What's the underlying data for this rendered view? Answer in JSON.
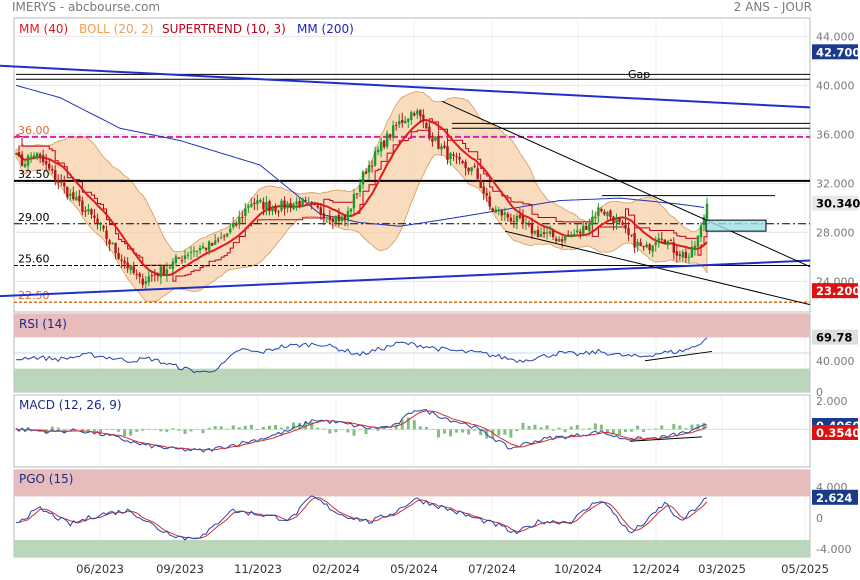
{
  "header": {
    "left": "IMERYS - abcbourse.com",
    "right": "2 ANS - JOUR"
  },
  "legend": [
    {
      "label": "MM (40)",
      "color": "#e31a1c"
    },
    {
      "label": "BOLL (20, 2)",
      "color": "#f0a050"
    },
    {
      "label": "SUPERTREND (10, 3)",
      "color": "#c0001b"
    },
    {
      "label": "MM (200)",
      "color": "#2222cc"
    }
  ],
  "x_labels": [
    "06/2023",
    "09/2023",
    "11/2023",
    "02/2024",
    "05/2024",
    "07/2024",
    "10/2024",
    "12/2024",
    "03/2025",
    "05/2025"
  ],
  "annotations": {
    "gap": "Gap"
  },
  "chart_data": [
    {
      "type": "candlestick",
      "name": "main",
      "y_ticks": [
        "44.000",
        "40.000",
        "36.000",
        "32.000",
        "28.000",
        "24.000"
      ],
      "ylim": [
        21.5,
        45.5
      ],
      "levels": [
        {
          "label": "36.00",
          "value": 35.8,
          "color": "#dd1fb0"
        },
        {
          "label": "32.50",
          "value": 32.2,
          "color": "#000000"
        },
        {
          "label": "29.00",
          "value": 28.7,
          "color": "#000000"
        },
        {
          "label": "25.60",
          "value": 25.3,
          "color": "#000000"
        },
        {
          "label": "22.50",
          "value": 22.3,
          "color": "#e07010"
        }
      ],
      "badges": [
        {
          "label": "42.700",
          "value": 42.7,
          "bg": "#1a3a8a",
          "fg": "#ffffff"
        },
        {
          "label": "30.340",
          "value": 30.34,
          "bg": "#e8e8e8",
          "fg": "#000000"
        },
        {
          "label": "23.200",
          "value": 23.2,
          "bg": "#dd1111",
          "fg": "#ffffff"
        }
      ],
      "close_key": [
        [
          0,
          40.0
        ],
        [
          10,
          37.0
        ],
        [
          20,
          33.5
        ],
        [
          35,
          34.5
        ],
        [
          50,
          33.0
        ],
        [
          70,
          31.0
        ],
        [
          95,
          29.0
        ],
        [
          115,
          26.5
        ],
        [
          140,
          24.0
        ],
        [
          165,
          25.0
        ],
        [
          190,
          26.5
        ],
        [
          215,
          27.0
        ],
        [
          235,
          28.5
        ],
        [
          250,
          30.5
        ],
        [
          275,
          30.0
        ],
        [
          300,
          30.5
        ],
        [
          325,
          29.5
        ],
        [
          345,
          29.0
        ],
        [
          365,
          33.0
        ],
        [
          385,
          35.5
        ],
        [
          400,
          37.0
        ],
        [
          415,
          38.0
        ],
        [
          430,
          36.0
        ],
        [
          445,
          34.5
        ],
        [
          460,
          33.5
        ],
        [
          475,
          33.0
        ],
        [
          490,
          30.0
        ],
        [
          515,
          29.0
        ],
        [
          535,
          28.0
        ],
        [
          560,
          27.5
        ],
        [
          580,
          28.0
        ],
        [
          600,
          30.0
        ],
        [
          615,
          29.0
        ],
        [
          630,
          27.5
        ],
        [
          645,
          26.5
        ],
        [
          660,
          28.0
        ],
        [
          675,
          26.5
        ],
        [
          690,
          26.0
        ],
        [
          700,
          28.0
        ],
        [
          707,
          30.34
        ]
      ],
      "ma200_key": [
        [
          16,
          40.0
        ],
        [
          60,
          39.0
        ],
        [
          120,
          36.5
        ],
        [
          180,
          35.5
        ],
        [
          260,
          33.5
        ],
        [
          320,
          29.5
        ],
        [
          360,
          28.8
        ],
        [
          400,
          28.5
        ],
        [
          440,
          29.0
        ],
        [
          500,
          29.8
        ],
        [
          560,
          30.6
        ],
        [
          620,
          30.8
        ],
        [
          680,
          30.3
        ],
        [
          707,
          30.0
        ]
      ],
      "supertrend_color": "#c0001b",
      "trendlines": [
        {
          "color": "#1f2fcc",
          "width": 2,
          "points": [
            [
              0,
              41.6
            ],
            [
              810,
              38.2
            ]
          ]
        },
        {
          "color": "#1f2fcc",
          "width": 2,
          "points": [
            [
              0,
              22.8
            ],
            [
              810,
              25.7
            ]
          ]
        },
        {
          "color": "#000000",
          "width": 1,
          "points": [
            [
              442,
              38.7
            ],
            [
              810,
              25.2
            ]
          ]
        },
        {
          "color": "#000000",
          "width": 1,
          "points": [
            [
              505,
              28.1
            ],
            [
              810,
              22.1
            ]
          ]
        }
      ],
      "hlines": [
        {
          "color": "#000000",
          "points": [
            [
              16,
              40.9
            ],
            [
              810,
              40.9
            ]
          ]
        },
        {
          "color": "#000000",
          "points": [
            [
              16,
              40.5
            ],
            [
              810,
              40.5
            ]
          ]
        },
        {
          "color": "#000000",
          "points": [
            [
              452,
              36.9
            ],
            [
              810,
              36.9
            ]
          ]
        },
        {
          "color": "#000000",
          "points": [
            [
              452,
              36.5
            ],
            [
              810,
              36.5
            ]
          ]
        },
        {
          "color": "#000000",
          "points": [
            [
              602,
              31.0
            ],
            [
              775,
              31.0
            ]
          ]
        },
        {
          "color": "#000000",
          "points": [
            [
              303,
              25.3
            ],
            [
              810,
              25.3
            ]
          ]
        }
      ],
      "box": {
        "x": [
          706,
          766
        ],
        "y": [
          29.0,
          28.1
        ],
        "color": "#9be0e6"
      }
    },
    {
      "type": "line",
      "name": "RSI",
      "title": "RSI (14)",
      "y_ticks": [
        "40.000",
        "0"
      ],
      "badge": {
        "label": "69.78",
        "bg": "#dddddd",
        "fg": "#000000"
      },
      "ylim": [
        0,
        100
      ],
      "zones": {
        "upper": 70,
        "lower": 30,
        "mid": 50
      },
      "key": [
        [
          0,
          38
        ],
        [
          30,
          45
        ],
        [
          60,
          42
        ],
        [
          90,
          48
        ],
        [
          110,
          44
        ],
        [
          130,
          40
        ],
        [
          150,
          43
        ],
        [
          170,
          35
        ],
        [
          190,
          28
        ],
        [
          205,
          25
        ],
        [
          220,
          32
        ],
        [
          240,
          55
        ],
        [
          260,
          50
        ],
        [
          280,
          58
        ],
        [
          300,
          60
        ],
        [
          320,
          62
        ],
        [
          340,
          55
        ],
        [
          360,
          48
        ],
        [
          380,
          55
        ],
        [
          400,
          63
        ],
        [
          420,
          60
        ],
        [
          440,
          55
        ],
        [
          460,
          52
        ],
        [
          480,
          50
        ],
        [
          500,
          45
        ],
        [
          520,
          40
        ],
        [
          540,
          45
        ],
        [
          560,
          50
        ],
        [
          580,
          48
        ],
        [
          600,
          52
        ],
        [
          620,
          47
        ],
        [
          640,
          45
        ],
        [
          660,
          50
        ],
        [
          680,
          52
        ],
        [
          695,
          58
        ],
        [
          707,
          69.78
        ]
      ],
      "trendline": [
        [
          645,
          40
        ],
        [
          712,
          52
        ]
      ]
    },
    {
      "type": "line",
      "name": "MACD",
      "title": "MACD (12, 26, 9)",
      "y_ticks": [
        "2.000",
        "0"
      ],
      "badges": [
        {
          "label": "0.4060",
          "bg": "#1a3a8a",
          "fg": "#ffffff"
        },
        {
          "label": "0.3540",
          "bg": "#dd1111",
          "fg": "#ffffff"
        }
      ],
      "ylim": [
        -3.5,
        3.2
      ],
      "key": [
        [
          16,
          0.0
        ],
        [
          50,
          -0.2
        ],
        [
          80,
          -0.1
        ],
        [
          110,
          -0.6
        ],
        [
          140,
          -1.4
        ],
        [
          170,
          -1.8
        ],
        [
          205,
          -2.0
        ],
        [
          230,
          -1.5
        ],
        [
          260,
          -0.9
        ],
        [
          290,
          -0.1
        ],
        [
          315,
          0.9
        ],
        [
          340,
          0.6
        ],
        [
          370,
          0.1
        ],
        [
          395,
          0.3
        ],
        [
          415,
          1.9
        ],
        [
          430,
          1.6
        ],
        [
          450,
          0.9
        ],
        [
          470,
          0.4
        ],
        [
          490,
          -0.6
        ],
        [
          510,
          -1.8
        ],
        [
          530,
          -1.2
        ],
        [
          550,
          -0.8
        ],
        [
          575,
          -0.6
        ],
        [
          600,
          -0.2
        ],
        [
          620,
          -0.8
        ],
        [
          640,
          -0.9
        ],
        [
          660,
          -0.8
        ],
        [
          680,
          -0.4
        ],
        [
          695,
          -0.1
        ],
        [
          707,
          0.406
        ]
      ],
      "trendline": [
        [
          630,
          -1.1
        ],
        [
          702,
          -0.7
        ]
      ]
    },
    {
      "type": "line",
      "name": "PGO",
      "title": "PGO (15)",
      "y_ticks": [
        "4.000",
        "0",
        "-4.000"
      ],
      "badge": {
        "label": "2.624",
        "bg": "#1a3a8a",
        "fg": "#ffffff"
      },
      "ylim": [
        -5,
        6.2
      ],
      "zones": {
        "upper": 2.8,
        "lower": -2.8
      },
      "key": [
        [
          16,
          -0.5
        ],
        [
          40,
          1.2
        ],
        [
          70,
          -0.8
        ],
        [
          100,
          0.5
        ],
        [
          130,
          1.0
        ],
        [
          160,
          -1.5
        ],
        [
          185,
          -2.6
        ],
        [
          205,
          -2.2
        ],
        [
          230,
          1.0
        ],
        [
          260,
          0.5
        ],
        [
          290,
          -0.2
        ],
        [
          312,
          2.8
        ],
        [
          340,
          0.5
        ],
        [
          370,
          -0.5
        ],
        [
          395,
          0.8
        ],
        [
          415,
          2.5
        ],
        [
          440,
          1.5
        ],
        [
          470,
          0.2
        ],
        [
          500,
          -1.0
        ],
        [
          515,
          -2.0
        ],
        [
          540,
          -0.4
        ],
        [
          570,
          -0.5
        ],
        [
          600,
          2.5
        ],
        [
          615,
          0.5
        ],
        [
          630,
          -2.0
        ],
        [
          650,
          0.0
        ],
        [
          665,
          2.0
        ],
        [
          680,
          -0.5
        ],
        [
          695,
          1.2
        ],
        [
          707,
          2.624
        ]
      ]
    }
  ]
}
